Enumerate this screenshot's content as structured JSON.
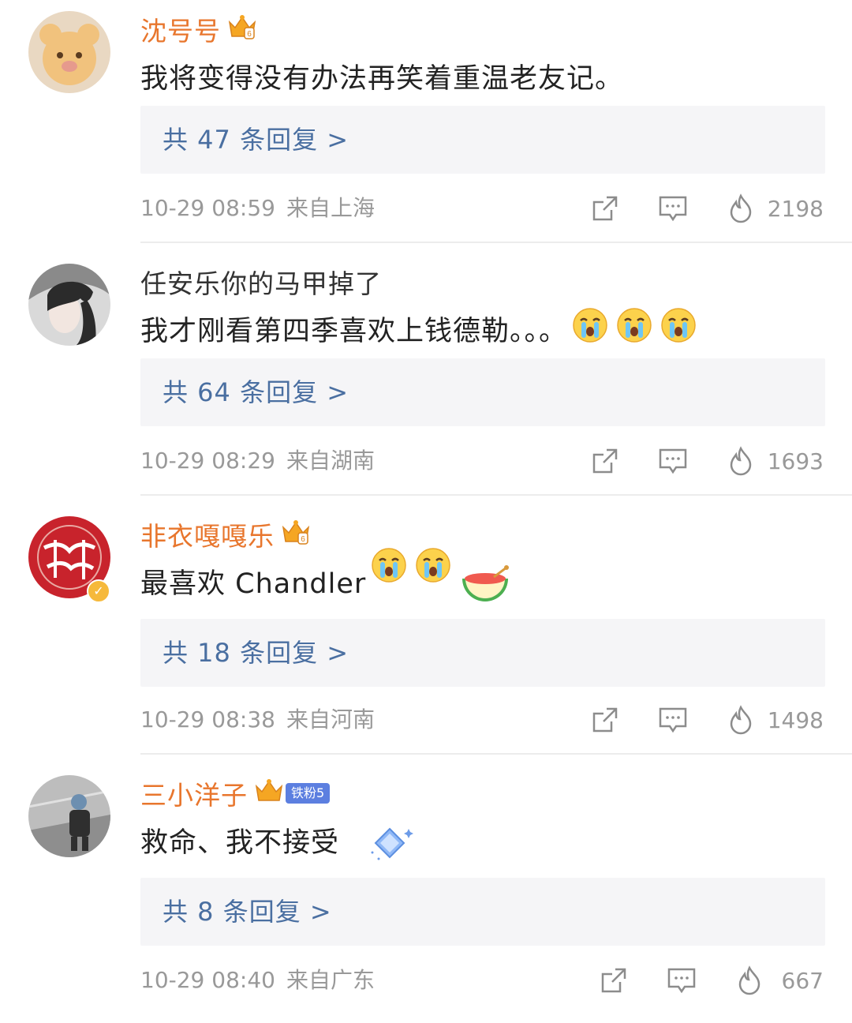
{
  "comments": [
    {
      "username": "沈号号",
      "username_color": "#e8762d",
      "badge": "crown-icon",
      "text": "我将变得没有办法再笑着重温老友记。",
      "emojis": [],
      "replies": "共 47 条回复 >",
      "time": "10-29 08:59",
      "location": "来自上海",
      "likes": "2198"
    },
    {
      "username": "任安乐你的马甲掉了",
      "username_color": "#333333",
      "badge": "",
      "text": "我才刚看第四季喜欢上钱德勒。。。",
      "emojis": [
        "crying-face-icon",
        "crying-face-icon",
        "crying-face-icon"
      ],
      "replies": "共 64 条回复 >",
      "time": "10-29 08:29",
      "location": "来自湖南",
      "likes": "1693"
    },
    {
      "username": "非衣嘎嘎乐",
      "username_color": "#e8762d",
      "badge": "crown-icon",
      "text": "最喜欢 Chandler",
      "emojis": [
        "crying-face-icon",
        "crying-face-icon",
        "watermelon-icon"
      ],
      "replies": "共 18 条回复 >",
      "time": "10-29 08:38",
      "location": "来自河南",
      "likes": "1498"
    },
    {
      "username": "三小洋子",
      "username_color": "#e8762d",
      "badge": "crown-icon",
      "fan_badge": "铁粉5",
      "text": "救命、我不接受",
      "emojis": [
        "diamond-sparkle-icon"
      ],
      "replies": "共 8 条回复 >",
      "time": "10-29 08:40",
      "location": "来自广东",
      "likes": "667"
    }
  ]
}
